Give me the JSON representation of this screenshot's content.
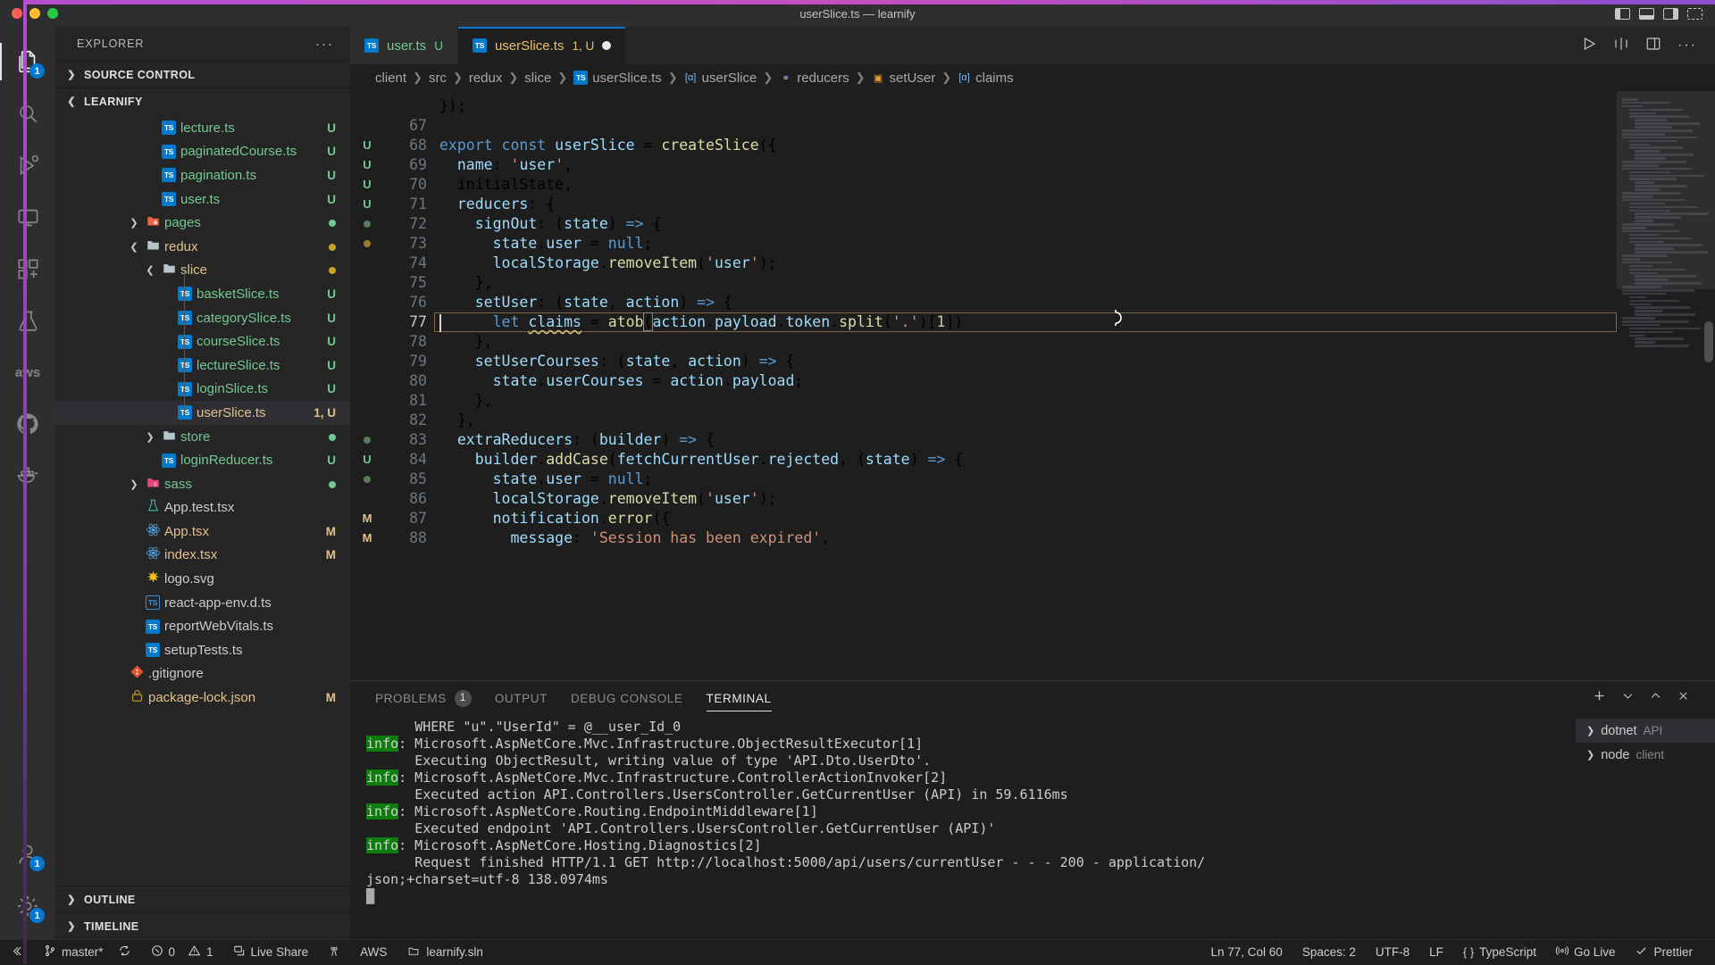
{
  "window": {
    "title": "userSlice.ts — learnify",
    "traffic_lights": [
      "close-red",
      "minimize-yellow",
      "maximize-green"
    ],
    "layout_icons": [
      "toggle-primary-sidebar",
      "toggle-panel",
      "toggle-secondary-sidebar",
      "customize-layout"
    ]
  },
  "activity_bar": {
    "items": [
      {
        "name": "explorer",
        "icon": "files-icon",
        "badge": "1",
        "active": true
      },
      {
        "name": "search",
        "icon": "search-icon",
        "badge": ""
      },
      {
        "name": "run-and-debug",
        "icon": "debug-icon",
        "badge": ""
      },
      {
        "name": "remote-explorer",
        "icon": "remote-icon",
        "badge": ""
      },
      {
        "name": "extensions",
        "icon": "extensions-icon",
        "badge": ""
      },
      {
        "name": "test-explorer",
        "icon": "beaker-icon",
        "badge": ""
      },
      {
        "name": "aws-toolkit",
        "icon": "aws-icon",
        "label": "aws",
        "badge": ""
      },
      {
        "name": "github",
        "icon": "github-icon",
        "badge": ""
      },
      {
        "name": "docker",
        "icon": "docker-icon",
        "badge": ""
      }
    ],
    "bottom_items": [
      {
        "name": "accounts",
        "icon": "account-icon",
        "badge": "1"
      },
      {
        "name": "manage-settings",
        "icon": "gear-icon",
        "badge": "1"
      }
    ]
  },
  "sidebar": {
    "header": "EXPLORER",
    "more_actions": "···",
    "sections": [
      {
        "label": "SOURCE CONTROL",
        "expanded": false
      },
      {
        "label": "LEARNIFY",
        "expanded": true
      }
    ],
    "files": [
      {
        "name": "lecture.ts",
        "icon": "ts-file-icon",
        "indent": 5,
        "status": "U",
        "color": "green",
        "kind": "file"
      },
      {
        "name": "paginatedCourse.ts",
        "icon": "ts-file-icon",
        "indent": 5,
        "status": "U",
        "color": "green",
        "kind": "file"
      },
      {
        "name": "pagination.ts",
        "icon": "ts-file-icon",
        "indent": 5,
        "status": "U",
        "color": "green",
        "kind": "file"
      },
      {
        "name": "user.ts",
        "icon": "ts-file-icon",
        "indent": 5,
        "status": "U",
        "color": "green",
        "kind": "file"
      },
      {
        "name": "pages",
        "icon": "folder-pages-icon",
        "indent": 4,
        "status": "dot-green",
        "color": "green",
        "kind": "folder",
        "expanded": false
      },
      {
        "name": "redux",
        "icon": "folder-icon",
        "indent": 4,
        "status": "dot-yellow",
        "color": "yellow",
        "kind": "folder",
        "expanded": true
      },
      {
        "name": "slice",
        "icon": "folder-icon",
        "indent": 5,
        "status": "dot-yellow",
        "color": "yellow",
        "kind": "folder",
        "expanded": true
      },
      {
        "name": "basketSlice.ts",
        "icon": "ts-file-icon",
        "indent": 6,
        "status": "U",
        "color": "green",
        "kind": "file"
      },
      {
        "name": "categorySlice.ts",
        "icon": "ts-file-icon",
        "indent": 6,
        "status": "U",
        "color": "green",
        "kind": "file"
      },
      {
        "name": "courseSlice.ts",
        "icon": "ts-file-icon",
        "indent": 6,
        "status": "U",
        "color": "green",
        "kind": "file"
      },
      {
        "name": "lectureSlice.ts",
        "icon": "ts-file-icon",
        "indent": 6,
        "status": "U",
        "color": "green",
        "kind": "file"
      },
      {
        "name": "loginSlice.ts",
        "icon": "ts-file-icon",
        "indent": 6,
        "status": "U",
        "color": "green",
        "kind": "file"
      },
      {
        "name": "userSlice.ts",
        "icon": "ts-file-icon",
        "indent": 6,
        "status": "1, U",
        "color": "yellow",
        "kind": "file",
        "selected": true
      },
      {
        "name": "store",
        "icon": "folder-icon",
        "indent": 5,
        "status": "dot-green",
        "color": "green",
        "kind": "folder",
        "expanded": false
      },
      {
        "name": "loginReducer.ts",
        "icon": "ts-file-icon",
        "indent": 5,
        "status": "U",
        "color": "green",
        "kind": "file"
      },
      {
        "name": "sass",
        "icon": "folder-sass-icon",
        "indent": 4,
        "status": "dot-green",
        "color": "green",
        "kind": "folder",
        "expanded": false
      },
      {
        "name": "App.test.tsx",
        "icon": "beaker-file-icon",
        "indent": 4,
        "status": "",
        "color": "white",
        "kind": "file"
      },
      {
        "name": "App.tsx",
        "icon": "react-icon",
        "indent": 4,
        "status": "M",
        "color": "yellow",
        "kind": "file"
      },
      {
        "name": "index.tsx",
        "icon": "react-icon",
        "indent": 4,
        "status": "M",
        "color": "yellow",
        "kind": "file"
      },
      {
        "name": "logo.svg",
        "icon": "svg-icon",
        "indent": 4,
        "status": "",
        "color": "white",
        "kind": "file"
      },
      {
        "name": "react-app-env.d.ts",
        "icon": "ts-def-icon",
        "indent": 4,
        "status": "",
        "color": "white",
        "kind": "file"
      },
      {
        "name": "reportWebVitals.ts",
        "icon": "ts-file-icon",
        "indent": 4,
        "status": "",
        "color": "white",
        "kind": "file"
      },
      {
        "name": "setupTests.ts",
        "icon": "ts-file-icon",
        "indent": 4,
        "status": "",
        "color": "white",
        "kind": "file"
      },
      {
        "name": ".gitignore",
        "icon": "git-icon",
        "indent": 3,
        "status": "",
        "color": "white",
        "kind": "file"
      },
      {
        "name": "package-lock.json",
        "icon": "npm-lock-icon",
        "indent": 3,
        "status": "M",
        "color": "yellow",
        "kind": "file"
      }
    ],
    "bottom_sections": [
      {
        "label": "OUTLINE",
        "expanded": false
      },
      {
        "label": "TIMELINE",
        "expanded": false
      }
    ]
  },
  "tabs": [
    {
      "label": "user.ts",
      "badge": "U",
      "icon": "ts-file-icon",
      "active": false,
      "dirty": false
    },
    {
      "label": "userSlice.ts",
      "badge": "1, U",
      "icon": "ts-file-icon",
      "active": true,
      "dirty": true
    }
  ],
  "tab_actions": [
    "run-icon",
    "split-editor-icon",
    "layout-icon",
    "more-actions-icon"
  ],
  "breadcrumb": [
    {
      "label": "client",
      "icon": ""
    },
    {
      "label": "src",
      "icon": ""
    },
    {
      "label": "redux",
      "icon": ""
    },
    {
      "label": "slice",
      "icon": ""
    },
    {
      "label": "userSlice.ts",
      "icon": "ts-file-icon"
    },
    {
      "label": "userSlice",
      "icon": "variable-symbol-icon"
    },
    {
      "label": "reducers",
      "icon": "property-symbol-icon"
    },
    {
      "label": "setUser",
      "icon": "method-symbol-icon"
    },
    {
      "label": "claims",
      "icon": "variable-symbol-icon"
    }
  ],
  "editor": {
    "first_line": 67,
    "current_line": 77,
    "lines": [
      {
        "no": 66,
        "partial": true,
        "text": "});"
      },
      {
        "no": 67,
        "text": ""
      },
      {
        "no": 68,
        "text": "export const userSlice = createSlice({"
      },
      {
        "no": 69,
        "text": "  name: 'user',"
      },
      {
        "no": 70,
        "text": "  initialState,"
      },
      {
        "no": 71,
        "text": "  reducers: {"
      },
      {
        "no": 72,
        "text": "    signOut: (state) => {"
      },
      {
        "no": 73,
        "text": "      state.user = null;"
      },
      {
        "no": 74,
        "text": "      localStorage.removeItem('user');"
      },
      {
        "no": 75,
        "text": "    },"
      },
      {
        "no": 76,
        "text": "    setUser: (state, action) => {"
      },
      {
        "no": 77,
        "text": "      let claims = atob(action.payload.token.split('.')[1])"
      },
      {
        "no": 78,
        "text": "    },"
      },
      {
        "no": 79,
        "text": "    setUserCourses: (state, action) => {"
      },
      {
        "no": 80,
        "text": "      state.userCourses = action.payload;"
      },
      {
        "no": 81,
        "text": "    },"
      },
      {
        "no": 82,
        "text": "  },"
      },
      {
        "no": 83,
        "text": "  extraReducers: (builder) => {"
      },
      {
        "no": 84,
        "text": "    builder.addCase(fetchCurrentUser.rejected, (state) => {"
      },
      {
        "no": 85,
        "text": "      state.user = null;"
      },
      {
        "no": 86,
        "text": "      localStorage.removeItem('user');"
      },
      {
        "no": 87,
        "text": "      notification.error({"
      },
      {
        "no": 88,
        "text": "        message: 'Session has been expired',"
      }
    ],
    "gutter_marks": [
      "",
      "",
      "U",
      "U",
      "U",
      "U",
      "dot-green",
      "dot-yellow",
      "",
      "",
      "",
      "",
      "",
      "",
      "",
      "",
      "",
      "dot-green",
      "U",
      "dot-green",
      "",
      "M",
      "M"
    ]
  },
  "panel": {
    "tabs": [
      {
        "label": "PROBLEMS",
        "badge": "1",
        "active": false
      },
      {
        "label": "OUTPUT",
        "badge": "",
        "active": false
      },
      {
        "label": "DEBUG CONSOLE",
        "badge": "",
        "active": false
      },
      {
        "label": "TERMINAL",
        "badge": "",
        "active": true
      }
    ],
    "actions": [
      "add-terminal-icon",
      "chevron-down-icon",
      "maximize-panel-icon",
      "close-panel-icon"
    ],
    "terminal_lines": [
      {
        "prefix": "",
        "text": "      WHERE \"u\".\"UserId\" = @__user_Id_0"
      },
      {
        "prefix": "info",
        "text": ": Microsoft.AspNetCore.Mvc.Infrastructure.ObjectResultExecutor[1]"
      },
      {
        "prefix": "",
        "text": "      Executing ObjectResult, writing value of type 'API.Dto.UserDto'."
      },
      {
        "prefix": "info",
        "text": ": Microsoft.AspNetCore.Mvc.Infrastructure.ControllerActionInvoker[2]"
      },
      {
        "prefix": "",
        "text": "      Executed action API.Controllers.UsersController.GetCurrentUser (API) in 59.6116ms"
      },
      {
        "prefix": "info",
        "text": ": Microsoft.AspNetCore.Routing.EndpointMiddleware[1]"
      },
      {
        "prefix": "",
        "text": "      Executed endpoint 'API.Controllers.UsersController.GetCurrentUser (API)'"
      },
      {
        "prefix": "info",
        "text": ": Microsoft.AspNetCore.Hosting.Diagnostics[2]"
      },
      {
        "prefix": "",
        "text": "      Request finished HTTP/1.1 GET http://localhost:5000/api/users/currentUser - - - 200 - application/"
      },
      {
        "prefix": "",
        "text": "json;+charset=utf-8 138.0974ms"
      }
    ],
    "terminal_list": [
      {
        "name": "dotnet",
        "sub": "API",
        "active": true
      },
      {
        "name": "node",
        "sub": "client",
        "active": false
      }
    ]
  },
  "statusbar": {
    "remote_icon": "remote-indicator-icon",
    "branch": "master*",
    "branch_icon": "source-control-icon",
    "sync_icon": "sync-icon",
    "errors": "0",
    "warnings": "1",
    "live_share": "Live Share",
    "live_share_icon": "live-share-icon",
    "radio_icon": "radio-tower-icon",
    "aws": "AWS",
    "solution": "learnify.sln",
    "solution_icon": "folder-icon",
    "cursor_position": "Ln 77, Col 60",
    "indentation": "Spaces: 2",
    "encoding": "UTF-8",
    "eol": "LF",
    "language": "TypeScript",
    "language_icon": "braces-icon",
    "go_live": "Go Live",
    "go_live_icon": "broadcast-icon",
    "prettier": "Prettier",
    "prettier_icon": "check-icon"
  },
  "colors": {
    "accent": "#0078d4",
    "modified": "#e2c08d",
    "untracked": "#73c991",
    "active_tab_fg": "#e7c06a",
    "bg": "#1e1e1e",
    "sidebar_bg": "#252526",
    "titlebar_bg": "#2e2e30"
  }
}
